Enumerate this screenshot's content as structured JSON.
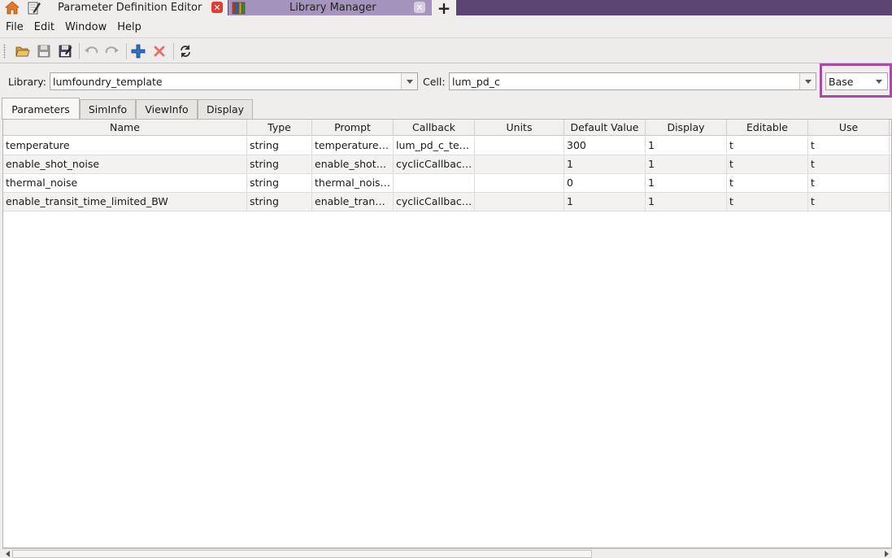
{
  "window_tabs": [
    {
      "title": "Parameter Definition Editor",
      "icon": "pencil-notepad-icon",
      "active": true
    },
    {
      "title": "Library Manager",
      "icon": "library-books-icon",
      "active": false
    }
  ],
  "tab_add_label": "+",
  "home_icon": "home-icon",
  "menu": [
    "File",
    "Edit",
    "Window",
    "Help"
  ],
  "toolbar_icons": [
    "open-folder-icon",
    "save-icon",
    "save-as-icon",
    "undo-icon",
    "redo-icon",
    "add-icon",
    "delete-icon",
    "refresh-icon"
  ],
  "library": {
    "label": "Library:",
    "value": "lumfoundry_template"
  },
  "cell": {
    "label": "Cell:",
    "value": "lum_pd_c"
  },
  "view": {
    "value": "Base"
  },
  "section_tabs": [
    "Parameters",
    "SimInfo",
    "ViewInfo",
    "Display"
  ],
  "table": {
    "columns": [
      "Name",
      "Type",
      "Prompt",
      "Callback",
      "Units",
      "Default Value",
      "Display",
      "Editable",
      "Use"
    ],
    "rows": [
      [
        "temperature",
        "string",
        "temperature…",
        "lum_pd_c_te…",
        "",
        "300",
        "1",
        "t",
        "t"
      ],
      [
        "enable_shot_noise",
        "string",
        "enable_shot…",
        "cyclicCallbac…",
        "",
        "1",
        "1",
        "t",
        "t"
      ],
      [
        "thermal_noise",
        "string",
        "thermal_nois…",
        "",
        "",
        "0",
        "1",
        "t",
        "t"
      ],
      [
        "enable_transit_time_limited_BW",
        "string",
        "enable_tran…",
        "cyclicCallbac…",
        "",
        "1",
        "1",
        "t",
        "t"
      ]
    ]
  },
  "colors": {
    "tabstrip": "#5b4471",
    "inactive_tab": "#a494bb",
    "highlight": "#a64ca6",
    "close_active": "#e03c31"
  }
}
